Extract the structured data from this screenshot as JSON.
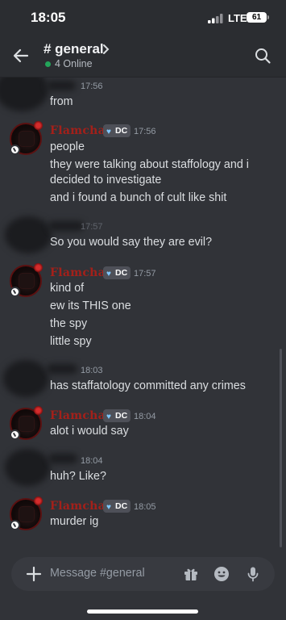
{
  "status_bar": {
    "time": "18:05",
    "network": "LTE",
    "battery": "61"
  },
  "header": {
    "channel": "# general",
    "online": "4 Online"
  },
  "messages": [
    {
      "time": "17:56",
      "lines": [
        "from"
      ]
    },
    {
      "author": "Flamchat",
      "tag": "DC",
      "time": "17:56",
      "lines": [
        "people",
        "they were talking about staffology and i",
        "decided to investigate",
        "and i found a bunch of cult like shit"
      ]
    },
    {
      "time": "17:57",
      "lines": [
        "So you would say they are evil?"
      ]
    },
    {
      "author": "Flamchat",
      "tag": "DC",
      "time": "17:57",
      "lines": [
        "kind of",
        "ew its THIS one",
        "the spy",
        "little spy"
      ]
    },
    {
      "time": "18:03",
      "lines": [
        "has staffatology committed any crimes"
      ]
    },
    {
      "author": "Flamchat",
      "tag": "DC",
      "time": "18:04",
      "lines": [
        "alot i would say"
      ]
    },
    {
      "time": "18:04",
      "lines": [
        "huh? Like?"
      ]
    },
    {
      "author": "Flamchat",
      "tag": "DC",
      "time": "18:05",
      "lines": [
        "murder ig"
      ]
    }
  ],
  "composer": {
    "placeholder": "Message #general"
  },
  "icons": {
    "back": "arrow-left-icon",
    "chevron": "chevron-right-icon",
    "search": "search-icon",
    "add": "plus-icon",
    "gift": "gift-icon",
    "emoji": "emoji-icon",
    "mic": "microphone-icon",
    "tag_heart": "heart-icon"
  },
  "colors": {
    "author": "#a3201a",
    "online": "#23a55a",
    "background": "#313338",
    "tag": "#4e5058"
  }
}
